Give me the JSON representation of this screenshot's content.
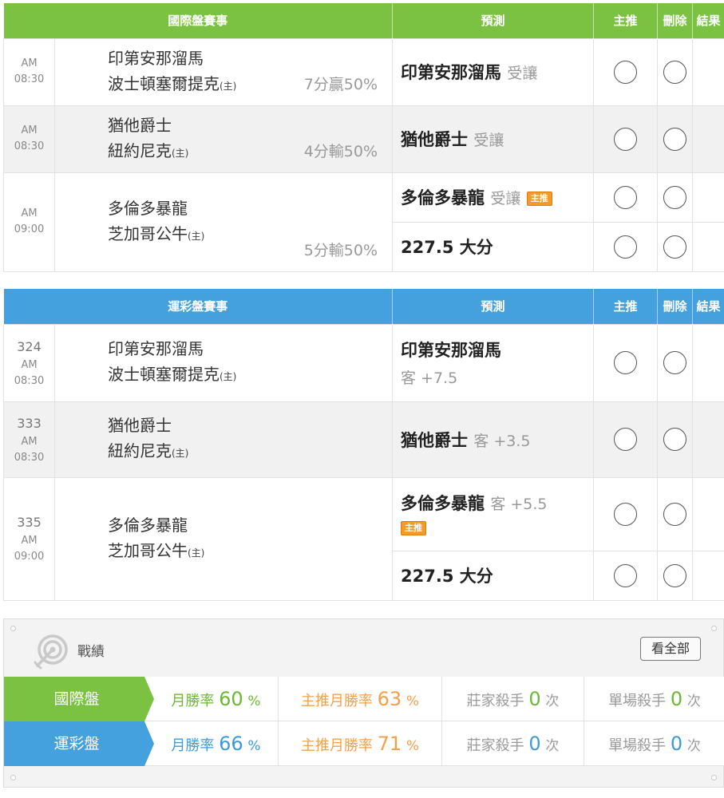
{
  "columns": {
    "predict": "預測",
    "main_pick": "主推",
    "delete": "刪除",
    "result": "結果"
  },
  "intl": {
    "title": "國際盤賽事",
    "games": [
      {
        "ampm": "AM",
        "time": "08:30",
        "away": "印第安那溜馬",
        "home": "波士頓塞爾提克",
        "home_mark": "(主)",
        "odds": "7分贏50%",
        "pick_team": "印第安那溜馬",
        "pick_type": "受讓"
      },
      {
        "ampm": "AM",
        "time": "08:30",
        "away": "猶他爵士",
        "home": "紐約尼克",
        "home_mark": "(主)",
        "odds": "4分輸50%",
        "pick_team": "猶他爵士",
        "pick_type": "受讓"
      },
      {
        "ampm": "AM",
        "time": "09:00",
        "away": "多倫多暴龍",
        "home": "芝加哥公牛",
        "home_mark": "(主)",
        "odds": "5分輸50%",
        "pick_team": "多倫多暴龍",
        "pick_type": "受讓",
        "badge": "主推",
        "total_pick": "227.5 大分"
      }
    ]
  },
  "lottery": {
    "title": "運彩盤賽事",
    "games": [
      {
        "num": "324",
        "ampm": "AM",
        "time": "08:30",
        "away": "印第安那溜馬",
        "home": "波士頓塞爾提克",
        "home_mark": "(主)",
        "pick_team": "印第安那溜馬",
        "pick_line": "客 +7.5"
      },
      {
        "num": "333",
        "ampm": "AM",
        "time": "08:30",
        "away": "猶他爵士",
        "home": "紐約尼克",
        "home_mark": "(主)",
        "pick_team": "猶他爵士",
        "pick_line": "客 +3.5"
      },
      {
        "num": "335",
        "ampm": "AM",
        "time": "09:00",
        "away": "多倫多暴龍",
        "home": "芝加哥公牛",
        "home_mark": "(主)",
        "pick_team": "多倫多暴龍",
        "pick_line": "客 +5.5",
        "badge": "主推",
        "total_pick": "227.5 大分"
      }
    ]
  },
  "record": {
    "title": "戰績",
    "view_all": "看全部",
    "icon": "target-icon",
    "rows": [
      {
        "label": "國際盤",
        "win_rate_label": "月勝率",
        "win_rate": "60",
        "main_rate_label": "主推月勝率",
        "main_rate": "63",
        "pct": "%",
        "banker_label": "莊家殺手",
        "banker": "0",
        "single_label": "單場殺手",
        "single": "0",
        "times": "次"
      },
      {
        "label": "運彩盤",
        "win_rate_label": "月勝率",
        "win_rate": "66",
        "main_rate_label": "主推月勝率",
        "main_rate": "71",
        "pct": "%",
        "banker_label": "莊家殺手",
        "banker": "0",
        "single_label": "單場殺手",
        "single": "0",
        "times": "次"
      }
    ]
  },
  "colors": {
    "green": "#7cc242",
    "blue": "#44a1dd",
    "orange": "#f49a2a"
  }
}
